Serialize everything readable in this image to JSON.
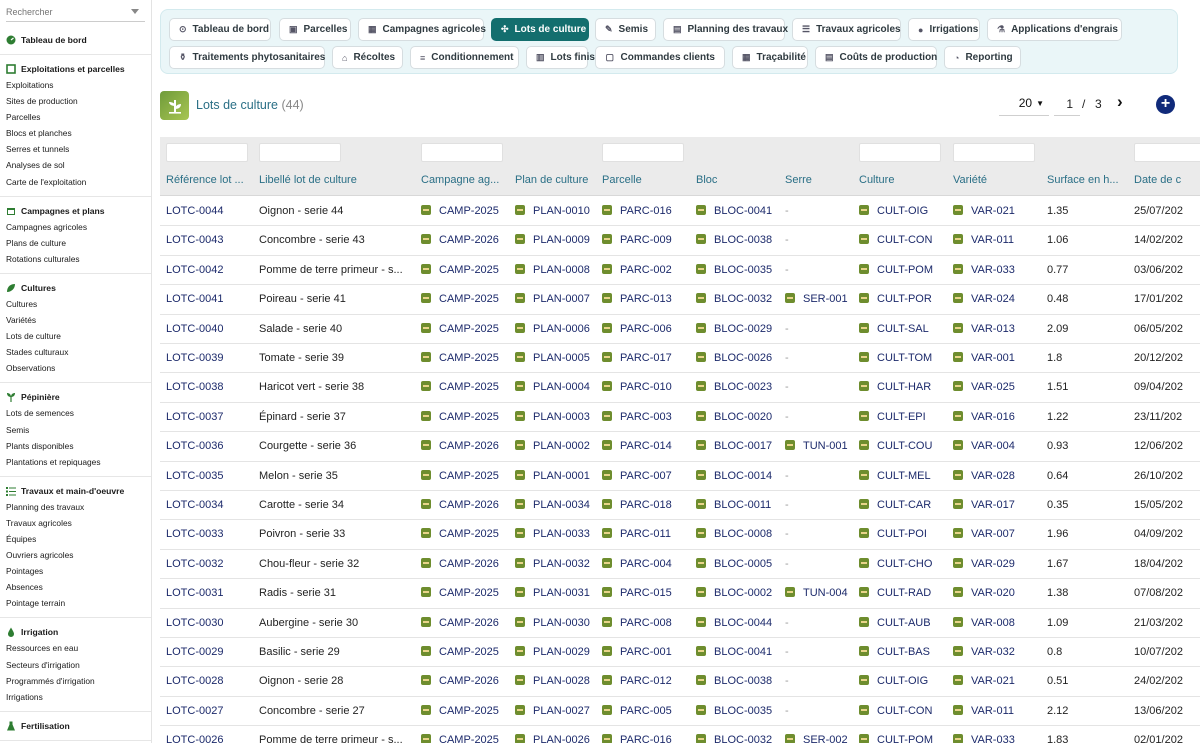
{
  "sidebar": {
    "search_placeholder": "Rechercher",
    "groups": [
      {
        "title": "Tableau de bord",
        "icon": "dashboard-icon",
        "items": []
      },
      {
        "title": "Exploitations et parcelles",
        "icon": "plots-icon",
        "items": [
          "Exploitations",
          "Sites de production",
          "Parcelles",
          "Blocs et planches",
          "Serres et tunnels",
          "Analyses de sol",
          "Carte de l'exploitation"
        ]
      },
      {
        "title": "Campagnes et plans",
        "icon": "calendar-icon",
        "items": [
          "Campagnes agricoles",
          "Plans de culture",
          "Rotations culturales"
        ]
      },
      {
        "title": "Cultures",
        "icon": "leaf-icon",
        "items": [
          "Cultures",
          "Variétés",
          "Lots de culture",
          "Stades culturaux",
          "Observations"
        ]
      },
      {
        "title": "Pépinière",
        "icon": "sprout-icon",
        "items": [
          "Lots de semences",
          "Semis",
          "Plants disponibles",
          "Plantations et repiquages"
        ]
      },
      {
        "title": "Travaux et main-d'oeuvre",
        "icon": "list-icon",
        "items": [
          "Planning des travaux",
          "Travaux agricoles",
          "Équipes",
          "Ouvriers agricoles",
          "Pointages",
          "Absences",
          "Pointage terrain"
        ]
      },
      {
        "title": "Irrigation",
        "icon": "drop-icon",
        "items": [
          "Ressources en eau",
          "Secteurs d'irrigation",
          "Programmés d'irrigation",
          "Irrigations"
        ]
      },
      {
        "title": "Fertilisation",
        "icon": "flask-icon",
        "items": []
      }
    ]
  },
  "tabs": [
    {
      "label": "Tableau de bord",
      "icon": "⊙"
    },
    {
      "label": "Parcelles",
      "icon": "▣"
    },
    {
      "label": "Campagnes agricoles",
      "icon": "▦"
    },
    {
      "label": "Lots de culture",
      "icon": "✣",
      "active": true
    },
    {
      "label": "Semis",
      "icon": "✎"
    },
    {
      "label": "Planning des travaux",
      "icon": "▤"
    },
    {
      "label": "Travaux agricoles",
      "icon": "☰"
    },
    {
      "label": "Irrigations",
      "icon": "●"
    },
    {
      "label": "Applications d'engrais",
      "icon": "⚗"
    },
    {
      "label": "Traitements phytosanitaires",
      "icon": "⚱"
    },
    {
      "label": "Récoltes",
      "icon": "⌂"
    },
    {
      "label": "Conditionnement",
      "icon": "≡"
    },
    {
      "label": "Lots finis",
      "icon": "▥"
    },
    {
      "label": "Commandes clients",
      "icon": "▢"
    },
    {
      "label": "Traçabilité",
      "icon": "▦"
    },
    {
      "label": "Coûts de production",
      "icon": "▤"
    },
    {
      "label": "Reporting",
      "icon": "◔"
    }
  ],
  "header": {
    "title": "Lots de culture",
    "count": "(44)",
    "page_size": "20",
    "page": "1",
    "page_sep": "/",
    "total_pages": "3",
    "next": "›",
    "add": "+"
  },
  "table": {
    "columns": [
      "Référence lot ...",
      "Libellé lot de culture",
      "Campagne ag...",
      "Plan de culture",
      "Parcelle",
      "Bloc",
      "Serre",
      "Culture",
      "Variété",
      "Surface en h...",
      "Date de c"
    ],
    "rows": [
      [
        "LOTC-0044",
        "Oignon - serie 44",
        "CAMP-2025",
        "PLAN-0010",
        "PARC-016",
        "BLOC-0041",
        "-",
        "CULT-OIG",
        "VAR-021",
        "1.35",
        "25/07/202"
      ],
      [
        "LOTC-0043",
        "Concombre - serie 43",
        "CAMP-2026",
        "PLAN-0009",
        "PARC-009",
        "BLOC-0038",
        "-",
        "CULT-CON",
        "VAR-011",
        "1.06",
        "14/02/202"
      ],
      [
        "LOTC-0042",
        "Pomme de terre primeur - s...",
        "CAMP-2025",
        "PLAN-0008",
        "PARC-002",
        "BLOC-0035",
        "-",
        "CULT-POM",
        "VAR-033",
        "0.77",
        "03/06/202"
      ],
      [
        "LOTC-0041",
        "Poireau - serie 41",
        "CAMP-2025",
        "PLAN-0007",
        "PARC-013",
        "BLOC-0032",
        "SER-001",
        "CULT-POR",
        "VAR-024",
        "0.48",
        "17/01/202"
      ],
      [
        "LOTC-0040",
        "Salade - serie 40",
        "CAMP-2025",
        "PLAN-0006",
        "PARC-006",
        "BLOC-0029",
        "-",
        "CULT-SAL",
        "VAR-013",
        "2.09",
        "06/05/202"
      ],
      [
        "LOTC-0039",
        "Tomate - serie 39",
        "CAMP-2025",
        "PLAN-0005",
        "PARC-017",
        "BLOC-0026",
        "-",
        "CULT-TOM",
        "VAR-001",
        "1.8",
        "20/12/202"
      ],
      [
        "LOTC-0038",
        "Haricot vert - serie 38",
        "CAMP-2025",
        "PLAN-0004",
        "PARC-010",
        "BLOC-0023",
        "-",
        "CULT-HAR",
        "VAR-025",
        "1.51",
        "09/04/202"
      ],
      [
        "LOTC-0037",
        "Épinard - serie 37",
        "CAMP-2025",
        "PLAN-0003",
        "PARC-003",
        "BLOC-0020",
        "-",
        "CULT-EPI",
        "VAR-016",
        "1.22",
        "23/11/202"
      ],
      [
        "LOTC-0036",
        "Courgette - serie 36",
        "CAMP-2026",
        "PLAN-0002",
        "PARC-014",
        "BLOC-0017",
        "TUN-001",
        "CULT-COU",
        "VAR-004",
        "0.93",
        "12/06/202"
      ],
      [
        "LOTC-0035",
        "Melon - serie 35",
        "CAMP-2025",
        "PLAN-0001",
        "PARC-007",
        "BLOC-0014",
        "-",
        "CULT-MEL",
        "VAR-028",
        "0.64",
        "26/10/202"
      ],
      [
        "LOTC-0034",
        "Carotte - serie 34",
        "CAMP-2026",
        "PLAN-0034",
        "PARC-018",
        "BLOC-0011",
        "-",
        "CULT-CAR",
        "VAR-017",
        "0.35",
        "15/05/202"
      ],
      [
        "LOTC-0033",
        "Poivron - serie 33",
        "CAMP-2025",
        "PLAN-0033",
        "PARC-011",
        "BLOC-0008",
        "-",
        "CULT-POI",
        "VAR-007",
        "1.96",
        "04/09/202"
      ],
      [
        "LOTC-0032",
        "Chou-fleur - serie 32",
        "CAMP-2026",
        "PLAN-0032",
        "PARC-004",
        "BLOC-0005",
        "-",
        "CULT-CHO",
        "VAR-029",
        "1.67",
        "18/04/202"
      ],
      [
        "LOTC-0031",
        "Radis - serie 31",
        "CAMP-2025",
        "PLAN-0031",
        "PARC-015",
        "BLOC-0002",
        "TUN-004",
        "CULT-RAD",
        "VAR-020",
        "1.38",
        "07/08/202"
      ],
      [
        "LOTC-0030",
        "Aubergine - serie 30",
        "CAMP-2026",
        "PLAN-0030",
        "PARC-008",
        "BLOC-0044",
        "-",
        "CULT-AUB",
        "VAR-008",
        "1.09",
        "21/03/202"
      ],
      [
        "LOTC-0029",
        "Basilic - serie 29",
        "CAMP-2025",
        "PLAN-0029",
        "PARC-001",
        "BLOC-0041",
        "-",
        "CULT-BAS",
        "VAR-032",
        "0.8",
        "10/07/202"
      ],
      [
        "LOTC-0028",
        "Oignon - serie 28",
        "CAMP-2026",
        "PLAN-0028",
        "PARC-012",
        "BLOC-0038",
        "-",
        "CULT-OIG",
        "VAR-021",
        "0.51",
        "24/02/202"
      ],
      [
        "LOTC-0027",
        "Concombre - serie 27",
        "CAMP-2025",
        "PLAN-0027",
        "PARC-005",
        "BLOC-0035",
        "-",
        "CULT-CON",
        "VAR-011",
        "2.12",
        "13/06/202"
      ],
      [
        "LOTC-0026",
        "Pomme de terre primeur - s...",
        "CAMP-2025",
        "PLAN-0026",
        "PARC-016",
        "BLOC-0032",
        "SER-002",
        "CULT-POM",
        "VAR-033",
        "1.83",
        "02/01/202"
      ]
    ]
  },
  "colors": {
    "accent": "#136e6e",
    "link": "#1c2a6b",
    "header_text": "#2a6f86",
    "chip": "#6e8d2e",
    "add_button": "#102a7a"
  }
}
